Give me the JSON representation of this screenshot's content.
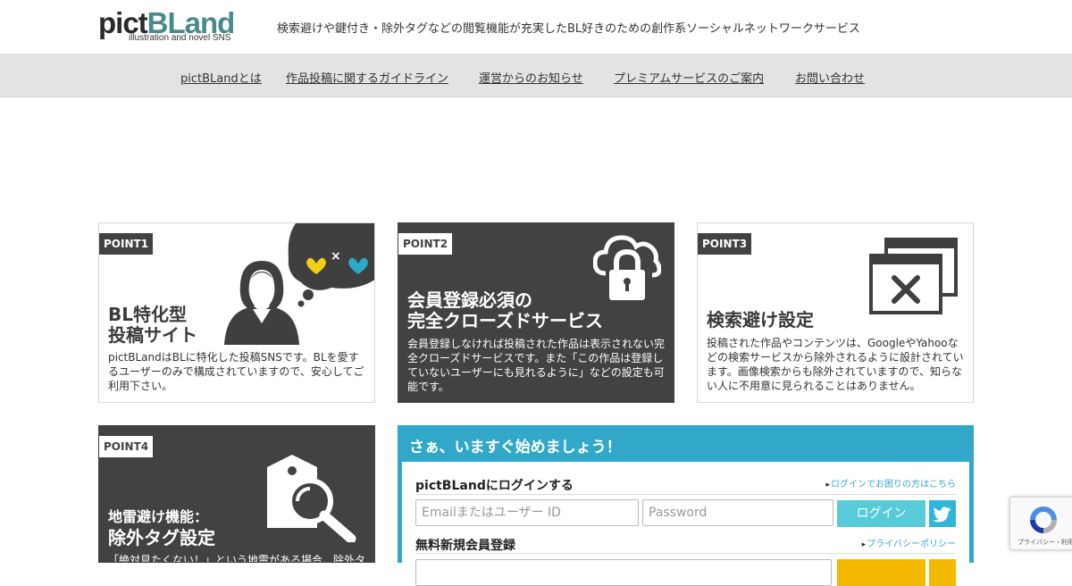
{
  "header": {
    "logo_pict": "pict",
    "logo_bland": "BLand",
    "logo_sub": "illustration and novel SNS",
    "tagline": "検索避けや鍵付き・除外タグなどの閲覧機能が充実したBL好きのための創作系ソーシャルネットワークサービス"
  },
  "nav": {
    "items": [
      {
        "label": "pictBLandとは"
      },
      {
        "label": "作品投稿に関するガイドライン"
      },
      {
        "label": "運営からのお知らせ"
      },
      {
        "label": "プレミアムサービスのご案内"
      },
      {
        "label": "お問い合わせ"
      }
    ]
  },
  "points": [
    {
      "badge": "POINT1",
      "title_line1": "BL特化型",
      "title_line2": "投稿サイト",
      "desc": "pictBLandはBLに特化した投稿SNSです。BLを愛するユーザーのみで構成されていますので、安心してご利用下さい。",
      "icon": "person-thinking-hearts-icon"
    },
    {
      "badge": "POINT2",
      "title_line1": "会員登録必須の",
      "title_line2": "完全クローズドサービス",
      "desc": "会員登録しなければ投稿された作品は表示されない完全クローズドサービスです。また「この作品は登録していないユーザーにも見れるように」などの設定も可能です。",
      "icon": "cloud-lock-icon"
    },
    {
      "badge": "POINT3",
      "title_line1": "検索避け設定",
      "desc": "投稿された作品やコンテンツは、GoogleやYahooなどの検索サービスから除外されるように設計されています。画像検索からも除外されていますので、知らない人に不用意に見られることはありません。",
      "icon": "blocked-windows-icon"
    },
    {
      "badge": "POINT4",
      "title_line1": "地雷避け機能：",
      "title_line2": "除外タグ設定",
      "desc": "「絶対見たくない！」という地雷がある場合、除外タ",
      "icon": "tag-search-icon"
    }
  ],
  "start": {
    "title": "さぁ、いますぐ始めましょう！",
    "login_title": "pictBLandにログインする",
    "login_help": "ログインでお困りの方はこちら",
    "email_placeholder": "Emailまたはユーザー ID",
    "password_placeholder": "Password",
    "login_button": "ログイン",
    "register_title": "無料新規会員登録",
    "privacy_link": "プライバシーポリシー"
  },
  "recaptcha": {
    "text": "プライバシー・利用規約"
  },
  "colors": {
    "accent": "#31a8c9",
    "dark_panel": "#424242",
    "logo_teal": "#4b8a8c",
    "nav_bg": "#e3e3e3"
  }
}
